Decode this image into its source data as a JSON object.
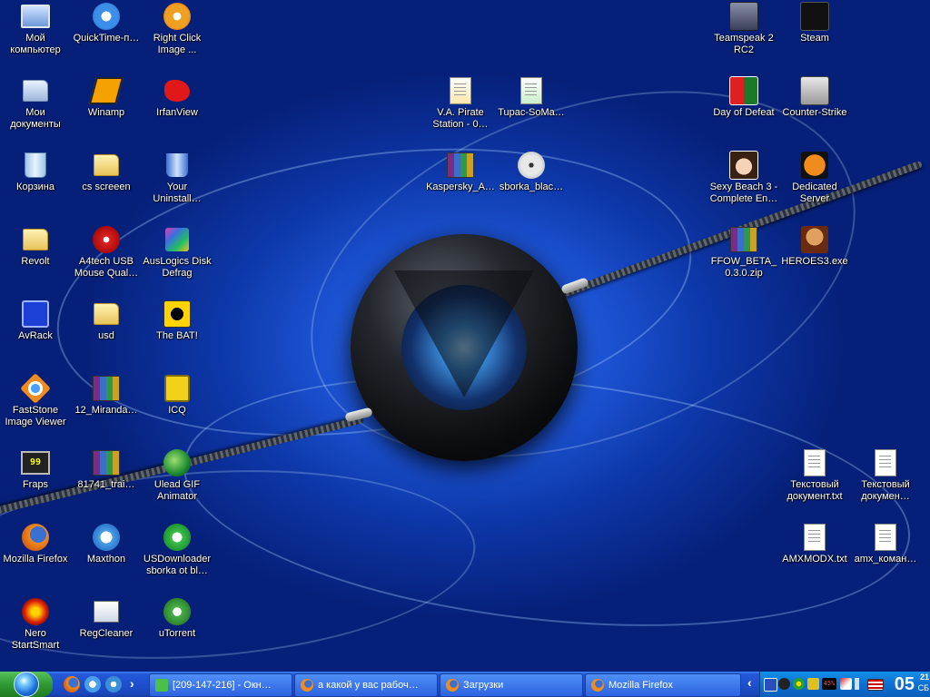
{
  "desktop": {
    "icons": [
      {
        "label": "Мой компьютер",
        "icon": "my-computer-icon"
      },
      {
        "label": "QuickTime-п…",
        "icon": "quicktime-icon"
      },
      {
        "label": "Right Click Image ...",
        "icon": "right-click-image-icon"
      },
      {
        "label": "Мои документы",
        "icon": "my-documents-icon"
      },
      {
        "label": "Winamp",
        "icon": "winamp-icon"
      },
      {
        "label": "IrfanView",
        "icon": "irfanview-icon"
      },
      {
        "label": "Корзина",
        "icon": "recycle-bin-icon"
      },
      {
        "label": "cs screeen",
        "icon": "folder-icon"
      },
      {
        "label": "Your Uninstall…",
        "icon": "uninstaller-icon"
      },
      {
        "label": "Revolt",
        "icon": "folder-icon"
      },
      {
        "label": "A4tech USB Mouse Qual…",
        "icon": "a4tech-mouse-icon"
      },
      {
        "label": "AusLogics Disk Defrag",
        "icon": "disk-defrag-icon"
      },
      {
        "label": "AvRack",
        "icon": "avrack-icon"
      },
      {
        "label": "usd",
        "icon": "folder-icon"
      },
      {
        "label": "The BAT!",
        "icon": "the-bat-icon"
      },
      {
        "label": "FastStone Image Viewer",
        "icon": "faststone-icon"
      },
      {
        "label": "12_Miranda…",
        "icon": "winrar-archive-icon"
      },
      {
        "label": "ICQ",
        "icon": "icq-icon"
      },
      {
        "label": "Fraps",
        "icon": "fraps-icon"
      },
      {
        "label": "81741_trai…",
        "icon": "winrar-archive-icon"
      },
      {
        "label": "Ulead GIF Animator",
        "icon": "ulead-gif-icon"
      },
      {
        "label": "Mozilla Firefox",
        "icon": "firefox-icon"
      },
      {
        "label": "Maxthon",
        "icon": "maxthon-icon"
      },
      {
        "label": "USDownloader sborka ot bl…",
        "icon": "usdownloader-icon"
      },
      {
        "label": "Nero StartSmart",
        "icon": "nero-icon"
      },
      {
        "label": "RegCleaner",
        "icon": "regcleaner-icon"
      },
      {
        "label": "uTorrent",
        "icon": "utorrent-icon"
      },
      {
        "label": "V.A. Pirate Station - 0…",
        "icon": "audio-file-icon"
      },
      {
        "label": "Tupac-SoMa…",
        "icon": "image-file-icon"
      },
      {
        "label": "Kaspersky_A…",
        "icon": "winrar-archive-icon"
      },
      {
        "label": "sborka_blac…",
        "icon": "disc-image-icon"
      },
      {
        "label": "Teamspeak 2 RC2",
        "icon": "teamspeak-icon"
      },
      {
        "label": "Steam",
        "icon": "steam-icon"
      },
      {
        "label": "Day of Defeat",
        "icon": "day-of-defeat-icon"
      },
      {
        "label": "Counter-Strike",
        "icon": "counter-strike-icon"
      },
      {
        "label": "Sexy Beach 3 - Complete En…",
        "icon": "sexy-beach-icon"
      },
      {
        "label": "Dedicated Server",
        "icon": "half-life-icon"
      },
      {
        "label": "FFOW_BETA_0.3.0.zip",
        "icon": "winrar-archive-icon"
      },
      {
        "label": "HEROES3.exe",
        "icon": "heroes3-icon"
      },
      {
        "label": "Текстовый документ.txt",
        "icon": "text-document-icon"
      },
      {
        "label": "Текстовый докумен…",
        "icon": "text-document-icon"
      },
      {
        "label": "AMXMODX.txt",
        "icon": "text-document-icon"
      },
      {
        "label": "amx_коман…",
        "icon": "text-document-icon"
      }
    ]
  },
  "taskbar": {
    "start_icon": "windows-start-icon",
    "quick_launch": [
      "firefox-icon",
      "maxthon-icon",
      "media-player-icon"
    ],
    "expand_label": "›",
    "tasks": [
      {
        "label": "[209-147-216] - Окн…",
        "icon": "chat-window-icon"
      },
      {
        "label": "а какой у вас рабоч…",
        "icon": "firefox-icon"
      },
      {
        "label": "Загрузки",
        "icon": "firefox-icon"
      },
      {
        "label": "Mozilla Firefox",
        "icon": "firefox-icon"
      }
    ],
    "tray": {
      "collapse_label": "‹",
      "icons": [
        "network-icon",
        "steam-icon",
        "icq-icon",
        "alert-icon",
        "cpu-meter-icon",
        "kaspersky-icon",
        "volume-icon",
        "language-flag-icon"
      ],
      "cpu_text": "45%",
      "clock_hour": "05",
      "clock_minute": "21",
      "clock_day": "СБ"
    }
  },
  "colors": {
    "desktop_blue": "#1d55d6",
    "taskbar_blue": "#2459d6",
    "start_green": "#2f9a33",
    "tray_blue": "#0d6fd2"
  }
}
